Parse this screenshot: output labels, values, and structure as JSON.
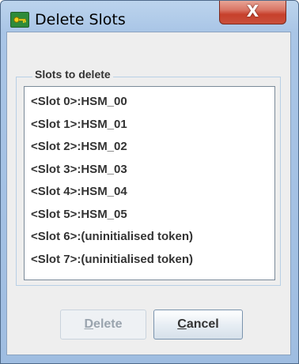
{
  "window": {
    "title": "Delete Slots",
    "close_glyph": "X"
  },
  "fieldset": {
    "legend": "Slots to delete"
  },
  "slots": [
    "<Slot 0>:HSM_00",
    "<Slot 1>:HSM_01",
    "<Slot 2>:HSM_02",
    "<Slot 3>:HSM_03",
    "<Slot 4>:HSM_04",
    "<Slot 5>:HSM_05",
    "<Slot 6>:(uninitialised token)",
    "<Slot 7>:(uninitialised token)"
  ],
  "buttons": {
    "delete": {
      "mnemonic": "D",
      "rest": "elete",
      "enabled": false
    },
    "cancel": {
      "mnemonic": "C",
      "rest": "ancel",
      "enabled": true
    }
  },
  "icons": {
    "app": "key-icon",
    "close": "close-icon"
  },
  "colors": {
    "title_bar": "#a9c5e6",
    "close_button": "#c7402b",
    "dialog_bg": "#eeeeee",
    "text": "#333333",
    "disabled_text": "#9aa4ae"
  }
}
